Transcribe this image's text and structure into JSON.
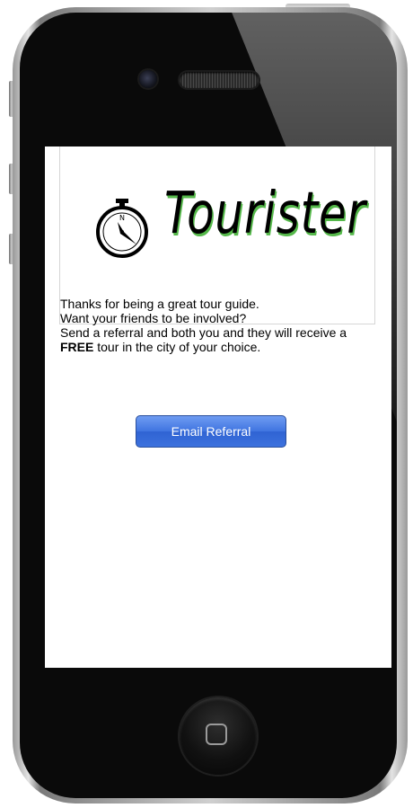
{
  "app": {
    "brand_name": "Tourister",
    "logo_icon": "compass-icon",
    "brand_color": "#55b84a"
  },
  "message": {
    "line1": "Thanks for being a great tour guide.",
    "line2": "Want your friends to be involved?",
    "line3": "Send a referral and both you and they will receive a",
    "line4_bold": "FREE",
    "line4_rest": " tour in the city of your choice."
  },
  "actions": {
    "email_referral_label": "Email Referral",
    "button_color": "#3f74e0"
  },
  "device": {
    "home_button_icon": "home-square-icon"
  }
}
